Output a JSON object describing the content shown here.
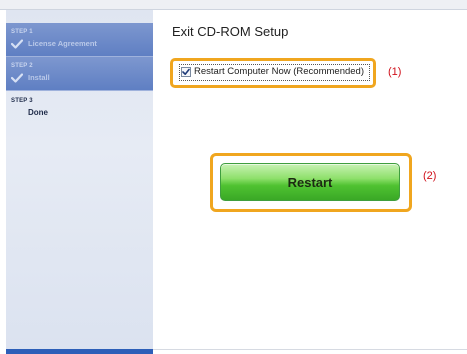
{
  "sidebar": {
    "steps": [
      {
        "number": "STEP 1",
        "label": "License Agreement",
        "state": "done"
      },
      {
        "number": "STEP 2",
        "label": "Install",
        "state": "done"
      },
      {
        "number": "STEP 3",
        "label": "Done",
        "state": "current"
      }
    ]
  },
  "main": {
    "title": "Exit CD-ROM Setup",
    "restart_checkbox": {
      "label": "Restart Computer Now (Recommended)",
      "checked": true
    },
    "restart_button_label": "Restart"
  },
  "callouts": [
    "(1)",
    "(2)"
  ],
  "colors": {
    "callout_red": "#d0101a",
    "highlight_orange": "#f0a61f",
    "button_green": "#4fc231",
    "sidebar_blue": "#5f7fc3"
  }
}
